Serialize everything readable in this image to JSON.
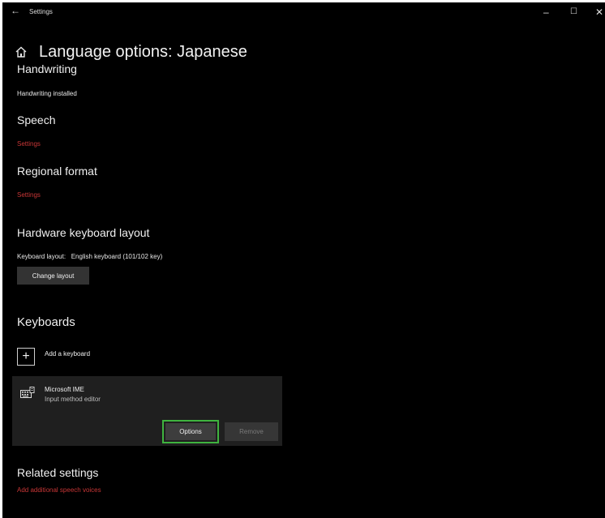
{
  "window": {
    "back_icon": "back-arrow-icon",
    "title": "Settings",
    "controls": {
      "minimize": "–",
      "maximize": "☐",
      "close": "✕"
    }
  },
  "page": {
    "home_icon": "home-icon",
    "title": "Language options: Japanese"
  },
  "handwriting": {
    "heading": "Handwriting",
    "status": "Handwriting installed"
  },
  "speech": {
    "heading": "Speech",
    "link": "Settings"
  },
  "regional_format": {
    "heading": "Regional format",
    "link": "Settings"
  },
  "hardware_keyboard": {
    "heading": "Hardware keyboard layout",
    "layout_label": "Keyboard layout:",
    "layout_value": "English keyboard (101/102 key)",
    "change_button": "Change layout"
  },
  "keyboards": {
    "heading": "Keyboards",
    "add_icon": "plus-icon",
    "add_label": "Add a keyboard",
    "items": [
      {
        "icon": "keyboard-icon",
        "name": "Microsoft IME",
        "description": "Input method editor",
        "options_button": "Options",
        "remove_button": "Remove"
      }
    ]
  },
  "related_settings": {
    "heading": "Related settings",
    "link": "Add additional speech voices"
  },
  "colors": {
    "background": "#000000",
    "link": "#c83636",
    "focus_border": "#3fb33f",
    "card": "#1f1f1f"
  }
}
